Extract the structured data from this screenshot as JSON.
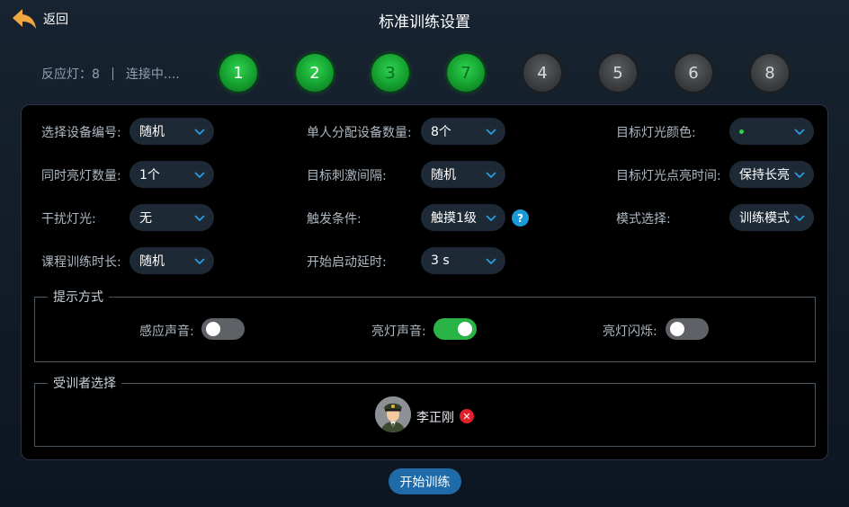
{
  "header": {
    "back_label": "返回",
    "title": "标准训练设置"
  },
  "status": {
    "reaction_lights_label": "反应灯：8",
    "connection": "连接中...."
  },
  "lamps": [
    {
      "label": "1",
      "state": "on"
    },
    {
      "label": "2",
      "state": "on"
    },
    {
      "label": "3",
      "state": "on-dim"
    },
    {
      "label": "7",
      "state": "on-dim"
    },
    {
      "label": "4",
      "state": "off"
    },
    {
      "label": "5",
      "state": "off"
    },
    {
      "label": "6",
      "state": "off"
    },
    {
      "label": "8",
      "state": "off"
    }
  ],
  "settings": {
    "device_number": {
      "label": "选择设备编号:",
      "value": "随机"
    },
    "per_person_devices": {
      "label": "单人分配设备数量:",
      "value": "8个"
    },
    "target_light_color": {
      "label": "目标灯光颜色:",
      "value_color": "#2fcf4f"
    },
    "simultaneous_lights": {
      "label": "同时亮灯数量:",
      "value": "1个"
    },
    "stimulus_interval": {
      "label": "目标刺激间隔:",
      "value": "随机"
    },
    "light_on_time": {
      "label": "目标灯光点亮时间:",
      "value": "保持长亮"
    },
    "distractor_light": {
      "label": "干扰灯光:",
      "value": "无"
    },
    "trigger_condition": {
      "label": "触发条件:",
      "value": "触摸1级",
      "help": "?"
    },
    "mode": {
      "label": "模式选择:",
      "value": "训练模式"
    },
    "course_duration": {
      "label": "课程训练时长:",
      "value": "随机"
    },
    "start_delay": {
      "label": "开始启动延时:",
      "value": "3 s"
    }
  },
  "prompt_mode": {
    "title": "提示方式",
    "sensor_sound": {
      "label": "感应声音:",
      "on": false
    },
    "light_sound": {
      "label": "亮灯声音:",
      "on": true
    },
    "light_flash": {
      "label": "亮灯闪烁:",
      "on": false
    }
  },
  "trainee": {
    "title": "受训者选择",
    "name": "李正刚",
    "remove": "✕"
  },
  "start_button": "开始训练",
  "colors": {
    "accent_green": "#2ab347",
    "accent_blue": "#1f6aa8",
    "help_blue": "#1a9ad6",
    "remove_red": "#e0202a"
  }
}
